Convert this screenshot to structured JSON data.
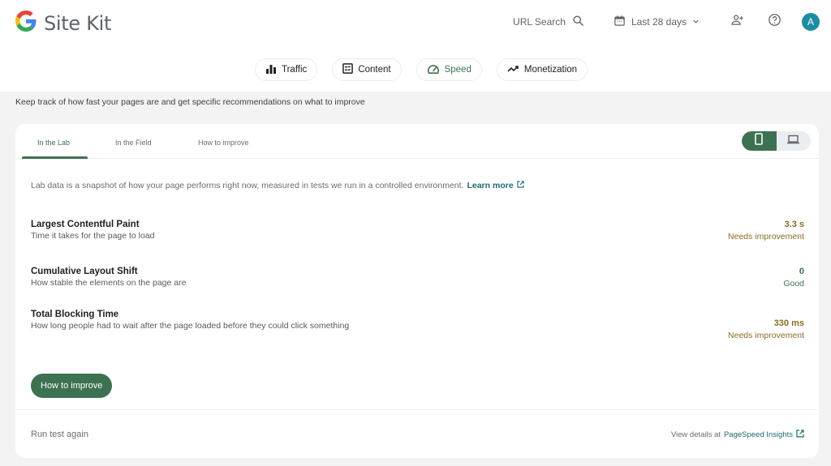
{
  "header": {
    "app_name": "Site Kit",
    "url_search_label": "URL Search",
    "date_range_label": "Last 28 days",
    "avatar_initial": "A"
  },
  "nav": {
    "chips": [
      {
        "label": "Traffic",
        "icon": "bar-chart-icon",
        "active": false
      },
      {
        "label": "Content",
        "icon": "content-list-icon",
        "active": false
      },
      {
        "label": "Speed",
        "icon": "speedometer-icon",
        "active": true
      },
      {
        "label": "Monetization",
        "icon": "trending-up-icon",
        "active": false
      }
    ]
  },
  "section": {
    "subtitle": "Keep track of how fast your pages are and get specific recommendations on what to improve"
  },
  "card": {
    "tabs": [
      {
        "label": "In the Lab",
        "active": true
      },
      {
        "label": "In the Field",
        "active": false
      },
      {
        "label": "How to improve",
        "active": false
      }
    ],
    "device_toggle": {
      "selected": "mobile",
      "options": [
        "mobile",
        "desktop"
      ]
    },
    "intro_text": "Lab data is a snapshot of how your page performs right now, measured in tests we run in a controlled environment.",
    "learn_more_label": "Learn more",
    "metrics": [
      {
        "name": "Largest Contentful Paint",
        "description": "Time it takes for the page to load",
        "value": "3.3 s",
        "status": "Needs improvement"
      },
      {
        "name": "Cumulative Layout Shift",
        "description": "How stable the elements on the page are",
        "value": "0",
        "status": "Good"
      },
      {
        "name": "Total Blocking Time",
        "description": "How long people had to wait after the page loaded before they could click something",
        "value": "330 ms",
        "status": "Needs improvement"
      }
    ],
    "how_to_improve_button": "How to improve",
    "run_test_again": "Run test again",
    "view_details_prefix": "View details at",
    "pagespeed_link": "PageSpeed Insights"
  },
  "colors": {
    "accent_green": "#3c7251",
    "link_teal": "#1b6b6f",
    "warning": "#8b6d22",
    "avatar": "#1a8ea0"
  }
}
